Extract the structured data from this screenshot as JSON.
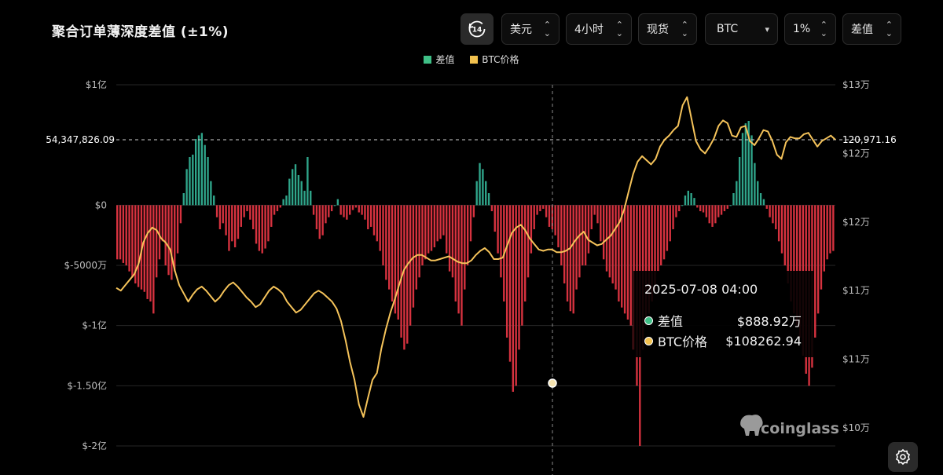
{
  "header": {
    "title": "聚合订单薄深度差值 (±1%)",
    "history_badge": "14",
    "controls": [
      {
        "label": "美元"
      },
      {
        "label": "4小时"
      },
      {
        "label": "现货"
      },
      {
        "label": "BTC"
      },
      {
        "label": "1%"
      },
      {
        "label": "差值"
      }
    ]
  },
  "legend": [
    {
      "label": "差值",
      "color": "#3fbf86"
    },
    {
      "label": "BTC价格",
      "color": "#f2c14e"
    }
  ],
  "chart_data": {
    "type": "bar",
    "left_axis": {
      "ticks": [
        100000000,
        0,
        -50000000,
        -100000000,
        -150000000,
        -200000000
      ],
      "labels": [
        "$1亿",
        "$0",
        "$-5000万",
        "$-1亿",
        "$-1.50亿",
        "$-2亿"
      ],
      "range": [
        -200000000,
        100000000
      ]
    },
    "right_axis": {
      "ticks": [
        130000,
        125000,
        120000,
        115000,
        110000,
        105000
      ],
      "labels": [
        "$13万",
        "$12万",
        "$12万",
        "$11万",
        "$11万",
        "$10万"
      ],
      "range": [
        104000,
        130000
      ]
    },
    "crosshair": {
      "left_value_label": "54,347,826.09",
      "right_value_label": "120,971.16"
    },
    "diff_bars": [
      -45,
      -45,
      -48,
      -50,
      -55,
      -60,
      -65,
      -68,
      -70,
      -72,
      -78,
      -80,
      -90,
      -60,
      -45,
      -30,
      -50,
      -58,
      -62,
      -55,
      -40,
      -15,
      10,
      30,
      40,
      42,
      55,
      58,
      60,
      50,
      40,
      20,
      8,
      -10,
      -20,
      -15,
      -25,
      -38,
      -30,
      -35,
      -28,
      -18,
      -10,
      -5,
      -12,
      -20,
      -32,
      -38,
      -40,
      -36,
      -30,
      -18,
      -8,
      -5,
      -2,
      5,
      8,
      22,
      30,
      34,
      25,
      20,
      12,
      40,
      12,
      -8,
      -20,
      -28,
      -25,
      -15,
      -10,
      -5,
      0,
      5,
      -8,
      -10,
      -12,
      -8,
      -4,
      -2,
      -6,
      -8,
      -12,
      -20,
      -18,
      -25,
      -30,
      -38,
      -50,
      -62,
      -70,
      -80,
      -90,
      -95,
      -110,
      -120,
      -115,
      -100,
      -85,
      -70,
      -60,
      -50,
      -45,
      -40,
      -38,
      -35,
      -30,
      -28,
      -25,
      -40,
      -55,
      -60,
      -80,
      -90,
      -100,
      -70,
      -50,
      -30,
      -10,
      20,
      35,
      30,
      20,
      10,
      -5,
      -22,
      -40,
      -60,
      -80,
      -110,
      -130,
      -155,
      -150,
      -120,
      -100,
      -80,
      -60,
      -40,
      -20,
      -8,
      -5,
      -3,
      -10,
      -18,
      -20,
      -25,
      -35,
      -50,
      -65,
      -80,
      -88,
      -90,
      -70,
      -60,
      -50,
      -50,
      -40,
      -20,
      -8,
      -15,
      -30,
      -45,
      -55,
      -60,
      -65,
      -70,
      -80,
      -85,
      -90,
      -95,
      -100,
      -120,
      -150,
      -200,
      -120,
      -100,
      -90,
      -80,
      -70,
      -55,
      -50,
      -45,
      -38,
      -30,
      -20,
      -10,
      -5,
      0,
      8,
      12,
      10,
      6,
      -2,
      -5,
      -6,
      -10,
      -15,
      -18,
      -15,
      -10,
      -8,
      -5,
      -3,
      0,
      10,
      20,
      40,
      60,
      68,
      70,
      58,
      35,
      20,
      10,
      5,
      -3,
      -10,
      -15,
      -20,
      -30,
      -40,
      -50,
      -65,
      -80,
      -90,
      -100,
      -110,
      -125,
      -140,
      -150,
      -135,
      -110,
      -90,
      -70,
      -55,
      -45,
      -40,
      -38
    ],
    "price_line": [
      115200,
      115000,
      115400,
      115800,
      116200,
      117000,
      118500,
      119200,
      119600,
      119400,
      118800,
      118500,
      118000,
      116500,
      115400,
      114800,
      114200,
      114700,
      115100,
      115300,
      115000,
      114600,
      114200,
      114500,
      115000,
      115400,
      115600,
      115300,
      114900,
      114500,
      114200,
      113800,
      114000,
      114500,
      115000,
      115300,
      115100,
      114800,
      114200,
      113800,
      113400,
      113600,
      114000,
      114400,
      114800,
      115000,
      114800,
      114500,
      114200,
      113700,
      112800,
      111400,
      109800,
      108500,
      106700,
      105800,
      107200,
      108500,
      109000,
      110800,
      112200,
      113400,
      114400,
      115500,
      116500,
      117000,
      117400,
      117600,
      117600,
      117400,
      117200,
      117200,
      117300,
      117400,
      117500,
      117300,
      117100,
      117000,
      117000,
      117200,
      117600,
      117900,
      118100,
      117800,
      117300,
      117300,
      117400,
      118300,
      119200,
      119600,
      119800,
      119400,
      118800,
      118400,
      118000,
      117900,
      118000,
      118000,
      117800,
      117800,
      117900,
      118100,
      118600,
      119000,
      119300,
      118700,
      118500,
      118300,
      118400,
      118700,
      119000,
      119500,
      120000,
      120900,
      122200,
      123500,
      124400,
      124800,
      124500,
      124200,
      124600,
      125500,
      126000,
      126300,
      126700,
      127000,
      128500,
      129100,
      127500,
      125900,
      125300,
      125000,
      125500,
      126100,
      127000,
      127400,
      127200,
      126300,
      126200,
      126900,
      127000,
      125900,
      125600,
      126100,
      126700,
      126600,
      125900,
      124900,
      124600,
      125800,
      126200,
      126100,
      126100,
      126400,
      126500,
      126000,
      125500,
      125900,
      126100,
      126300,
      126000
    ],
    "crosshair_point": {
      "date": "2025-07-08 04:00",
      "diff": 8889200,
      "price": 108262.94
    }
  },
  "tooltip": {
    "date": "2025-07-08 04:00",
    "rows": [
      {
        "label": "差值",
        "value": "$888.92万",
        "color": "#3fbf86"
      },
      {
        "label": "BTC价格",
        "value": "$108262.94",
        "color": "#f2c14e"
      }
    ]
  },
  "watermark": "coinglass"
}
